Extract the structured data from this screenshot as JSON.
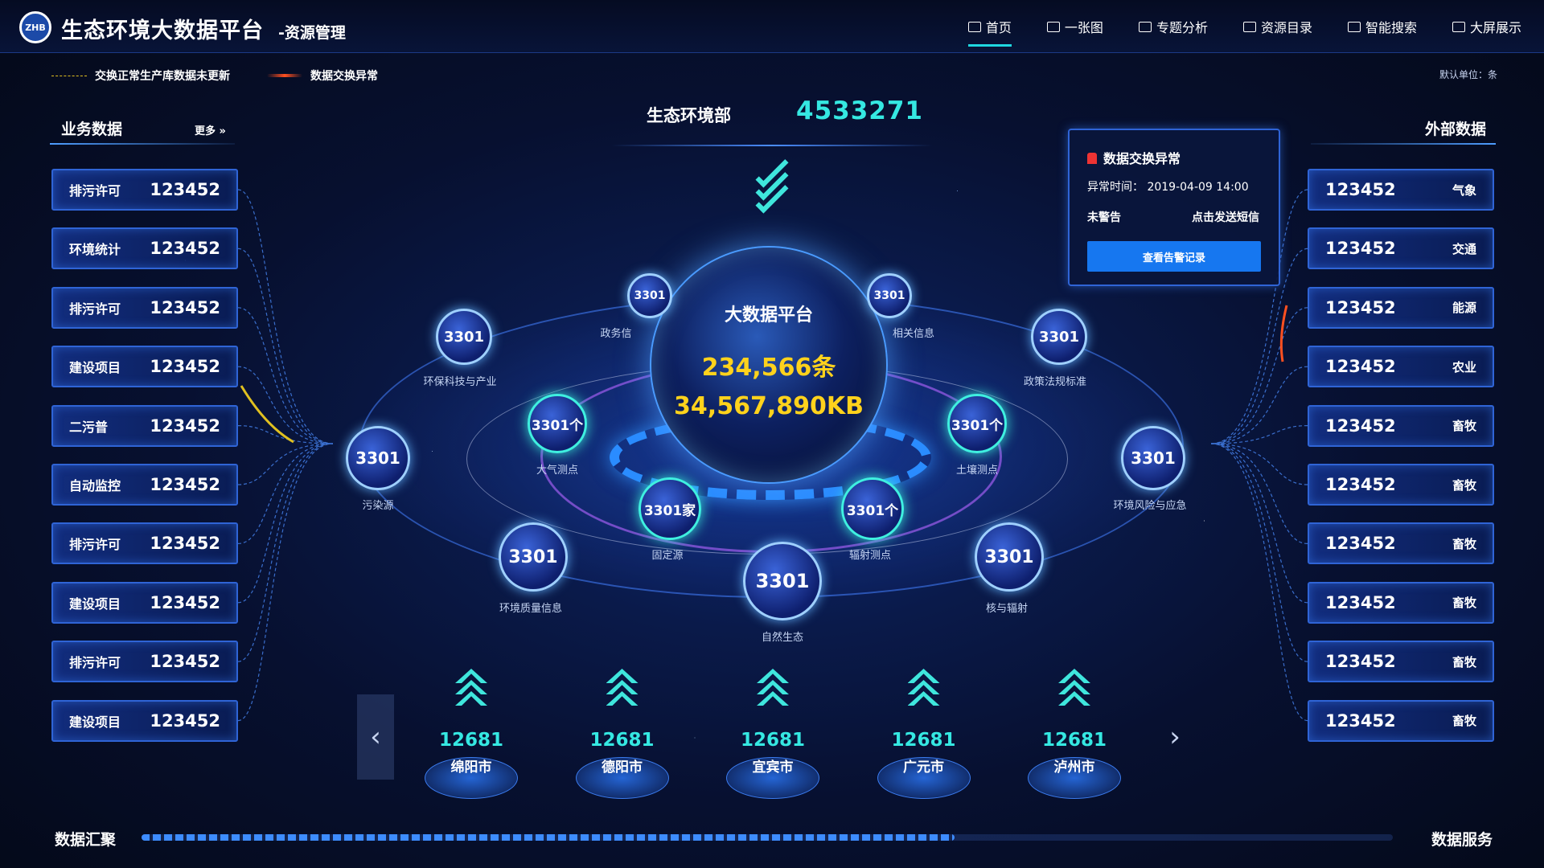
{
  "header": {
    "title": "生态环境大数据平台",
    "subtitle": "-资源管理",
    "logo_text": "ZHB",
    "nav": [
      {
        "label": "首页",
        "active": true
      },
      {
        "label": "一张图"
      },
      {
        "label": "专题分析"
      },
      {
        "label": "资源目录"
      },
      {
        "label": "智能搜索"
      },
      {
        "label": "大屏展示"
      }
    ]
  },
  "legend": {
    "normal": "交换正常生产库数据未更新",
    "error": "数据交换异常"
  },
  "unit": "默认单位：条",
  "left": {
    "title": "业务数据",
    "more": "更多",
    "items": [
      {
        "label": "排污许可",
        "value": "123452"
      },
      {
        "label": "环境统计",
        "value": "123452"
      },
      {
        "label": "排污许可",
        "value": "123452"
      },
      {
        "label": "建设项目",
        "value": "123452"
      },
      {
        "label": "二污普",
        "value": "123452"
      },
      {
        "label": "自动监控",
        "value": "123452"
      },
      {
        "label": "排污许可",
        "value": "123452"
      },
      {
        "label": "建设项目",
        "value": "123452"
      },
      {
        "label": "排污许可",
        "value": "123452"
      },
      {
        "label": "建设项目",
        "value": "123452"
      }
    ]
  },
  "right": {
    "title": "外部数据",
    "items": [
      {
        "label": "气象",
        "value": "123452"
      },
      {
        "label": "交通",
        "value": "123452"
      },
      {
        "label": "能源",
        "value": "123452"
      },
      {
        "label": "农业",
        "value": "123452"
      },
      {
        "label": "畜牧",
        "value": "123452"
      },
      {
        "label": "畜牧",
        "value": "123452"
      },
      {
        "label": "畜牧",
        "value": "123452"
      },
      {
        "label": "畜牧",
        "value": "123452"
      },
      {
        "label": "畜牧",
        "value": "123452"
      },
      {
        "label": "畜牧",
        "value": "123452"
      }
    ]
  },
  "top": {
    "name": "生态环境部",
    "value": "4533271"
  },
  "center": {
    "title": "大数据平台",
    "count": "234,566条",
    "size": "34,567,890KB"
  },
  "nodes": [
    {
      "value": "3301",
      "label": "政务信"
    },
    {
      "value": "3301",
      "label": "相关信息"
    },
    {
      "value": "3301",
      "label": "环保科技与产业"
    },
    {
      "value": "3301",
      "label": "政策法规标准"
    },
    {
      "value": "3301个",
      "label": "大气测点"
    },
    {
      "value": "3301个",
      "label": "土壤测点"
    },
    {
      "value": "3301",
      "label": "污染源"
    },
    {
      "value": "3301",
      "label": "环境风险与应急"
    },
    {
      "value": "3301家",
      "label": "固定源"
    },
    {
      "value": "3301个",
      "label": "辐射测点"
    },
    {
      "value": "3301",
      "label": "环境质量信息"
    },
    {
      "value": "3301",
      "label": "核与辐射"
    },
    {
      "value": "3301",
      "label": "自然生态"
    }
  ],
  "alert": {
    "title": "数据交换异常",
    "time_label": "异常时间：",
    "time": "2019-04-09 14:00",
    "status": "未警告",
    "send": "点击发送短信",
    "button": "查看告警记录"
  },
  "cities": [
    {
      "value": "12681",
      "name": "绵阳市"
    },
    {
      "value": "12681",
      "name": "德阳市"
    },
    {
      "value": "12681",
      "name": "宜宾市"
    },
    {
      "value": "12681",
      "name": "广元市"
    },
    {
      "value": "12681",
      "name": "泸州市"
    }
  ],
  "bottom": {
    "left": "数据汇聚",
    "right": "数据服务",
    "progress": 0.65
  },
  "colors": {
    "accent": "#35e8e2",
    "highlight": "#ffd21c",
    "card_border": "#2f64d6",
    "button": "#1677f0"
  }
}
